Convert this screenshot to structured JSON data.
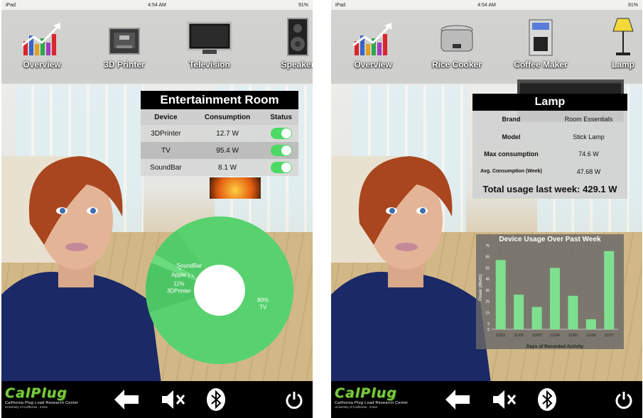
{
  "left": {
    "status": {
      "carrier": "iPad",
      "time": "4:54 AM",
      "battery": "91%"
    },
    "dock": [
      {
        "label": "Overview",
        "icon": "overview-chart-icon"
      },
      {
        "label": "3D Printer",
        "icon": "3d-printer-icon"
      },
      {
        "label": "Television",
        "icon": "television-icon"
      },
      {
        "label": "Speaker",
        "icon": "speaker-icon"
      }
    ],
    "room": {
      "title": "Entertainment Room",
      "headers": [
        "Device",
        "Consumption",
        "Status"
      ],
      "rows": [
        {
          "device": "3DPrinter",
          "consumption": "12.7 W",
          "on": true
        },
        {
          "device": "TV",
          "consumption": "95.4 W",
          "on": true
        },
        {
          "device": "SoundBar",
          "consumption": "8.1 W",
          "on": true
        }
      ]
    },
    "pie": {
      "slices": [
        {
          "pct": "80%",
          "name": "TV",
          "value": 80
        },
        {
          "pct": "11%",
          "name": "3DPrinter",
          "value": 11
        },
        {
          "pct": "2%",
          "name": "Apple TV",
          "value": 2
        },
        {
          "pct": "",
          "name": "SoundBar",
          "value": 7
        }
      ],
      "colors": [
        "#58d26f",
        "#4cc665",
        "#6adb7e",
        "#52cb6a"
      ]
    }
  },
  "right": {
    "status": {
      "carrier": "iPad",
      "time": "4:54 AM",
      "battery": "91%"
    },
    "dock": [
      {
        "label": "Overview",
        "icon": "overview-chart-icon"
      },
      {
        "label": "Rice Cooker",
        "icon": "rice-cooker-icon"
      },
      {
        "label": "Coffee Maker",
        "icon": "coffee-maker-icon"
      },
      {
        "label": "Lamp",
        "icon": "lamp-icon"
      }
    ],
    "lamp": {
      "title": "Lamp",
      "on": false,
      "rows": [
        {
          "k": "Brand",
          "v": "Room Essentials"
        },
        {
          "k": "Model",
          "v": "Stick Lamp"
        },
        {
          "k": "Max consumption",
          "v": "74.6 W"
        },
        {
          "k": "Avg. Consumption (Week)",
          "v": "47.68 W"
        }
      ],
      "total": "Total usage last week: 429.1 W"
    }
  },
  "footer": {
    "logo_text": "CalPlug",
    "logo_sub": "California Plug Load Research Center",
    "logo_sub2": "University of California · Irvine"
  },
  "chart_data": {
    "type": "bar",
    "title": "Device Usage Over Past Week",
    "xlabel": "Days of Recorded Activity",
    "ylabel": "Power (Watts)",
    "categories": [
      "11/01",
      "11/02",
      "11/03",
      "11/04",
      "11/05",
      "11/06",
      "11/07"
    ],
    "values": [
      62,
      31,
      20,
      55,
      30,
      9,
      70
    ],
    "ylim": [
      0,
      75
    ],
    "yticks": [
      0,
      5,
      15,
      25,
      35,
      45,
      55,
      65,
      75
    ],
    "bar_color": "#7ee08f"
  }
}
